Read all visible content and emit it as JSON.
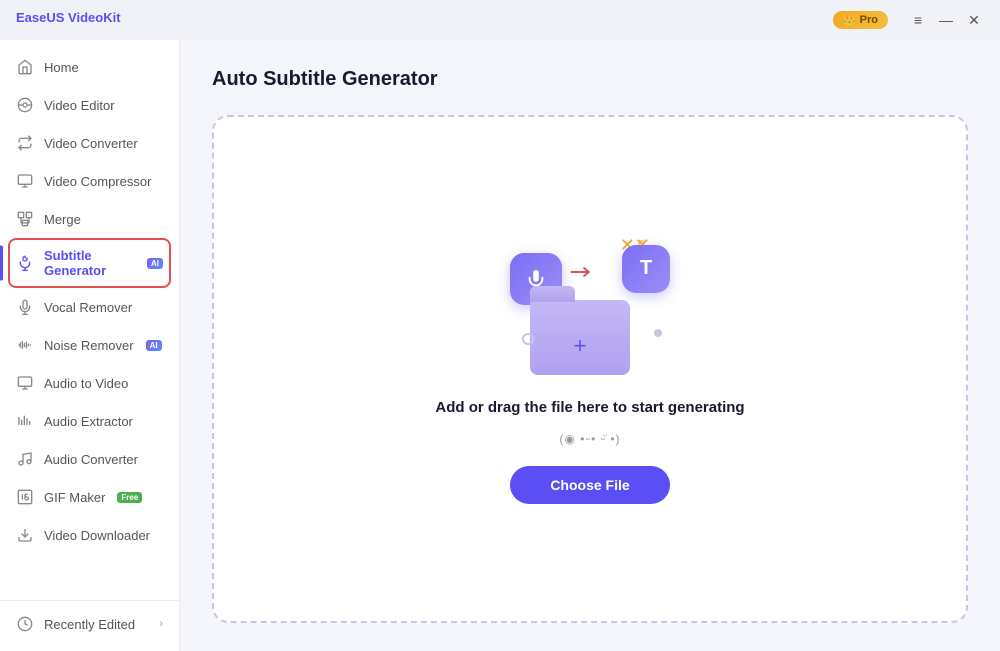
{
  "titlebar": {
    "logo": "EaseUS VideoKit",
    "pro_label": "Pro",
    "btn_menu": "≡",
    "btn_min": "—",
    "btn_close": "✕"
  },
  "sidebar": {
    "items": [
      {
        "id": "home",
        "label": "Home",
        "icon": "🏠",
        "active": false,
        "badge": null
      },
      {
        "id": "video-editor",
        "label": "Video Editor",
        "icon": "✂️",
        "active": false,
        "badge": null
      },
      {
        "id": "video-converter",
        "label": "Video Converter",
        "icon": "🔄",
        "active": false,
        "badge": null
      },
      {
        "id": "video-compressor",
        "label": "Video Compressor",
        "icon": "📋",
        "active": false,
        "badge": null
      },
      {
        "id": "merge",
        "label": "Merge",
        "icon": "⊞",
        "active": false,
        "badge": null
      },
      {
        "id": "subtitle-generator",
        "label": "Subtitle Generator",
        "icon": "🎵",
        "active": true,
        "badge": "AI"
      },
      {
        "id": "vocal-remover",
        "label": "Vocal Remover",
        "icon": "🎤",
        "active": false,
        "badge": null
      },
      {
        "id": "noise-remover",
        "label": "Noise Remover",
        "icon": "🎛️",
        "active": false,
        "badge": "AI"
      },
      {
        "id": "audio-to-video",
        "label": "Audio to Video",
        "icon": "📺",
        "active": false,
        "badge": null
      },
      {
        "id": "audio-extractor",
        "label": "Audio Extractor",
        "icon": "📊",
        "active": false,
        "badge": null
      },
      {
        "id": "audio-converter",
        "label": "Audio Converter",
        "icon": "🎵",
        "active": false,
        "badge": null
      },
      {
        "id": "gif-maker",
        "label": "GIF Maker",
        "icon": "🎞️",
        "active": false,
        "badge": "Free"
      }
    ],
    "bottom_item": {
      "label": "Recently Edited",
      "icon": "🕐"
    }
  },
  "main": {
    "title": "Auto Subtitle Generator",
    "drop_zone": {
      "main_text": "Add or drag the file here to start generating",
      "sub_text": "(◉ •ᵕ• ᵕ̈ •)",
      "button_label": "Choose File"
    }
  },
  "colors": {
    "accent": "#5b4ef5",
    "pro_gold": "#f5a623",
    "active_border": "#e05050",
    "ai_badge": "#7b5ef5",
    "free_badge": "#4caf50"
  }
}
